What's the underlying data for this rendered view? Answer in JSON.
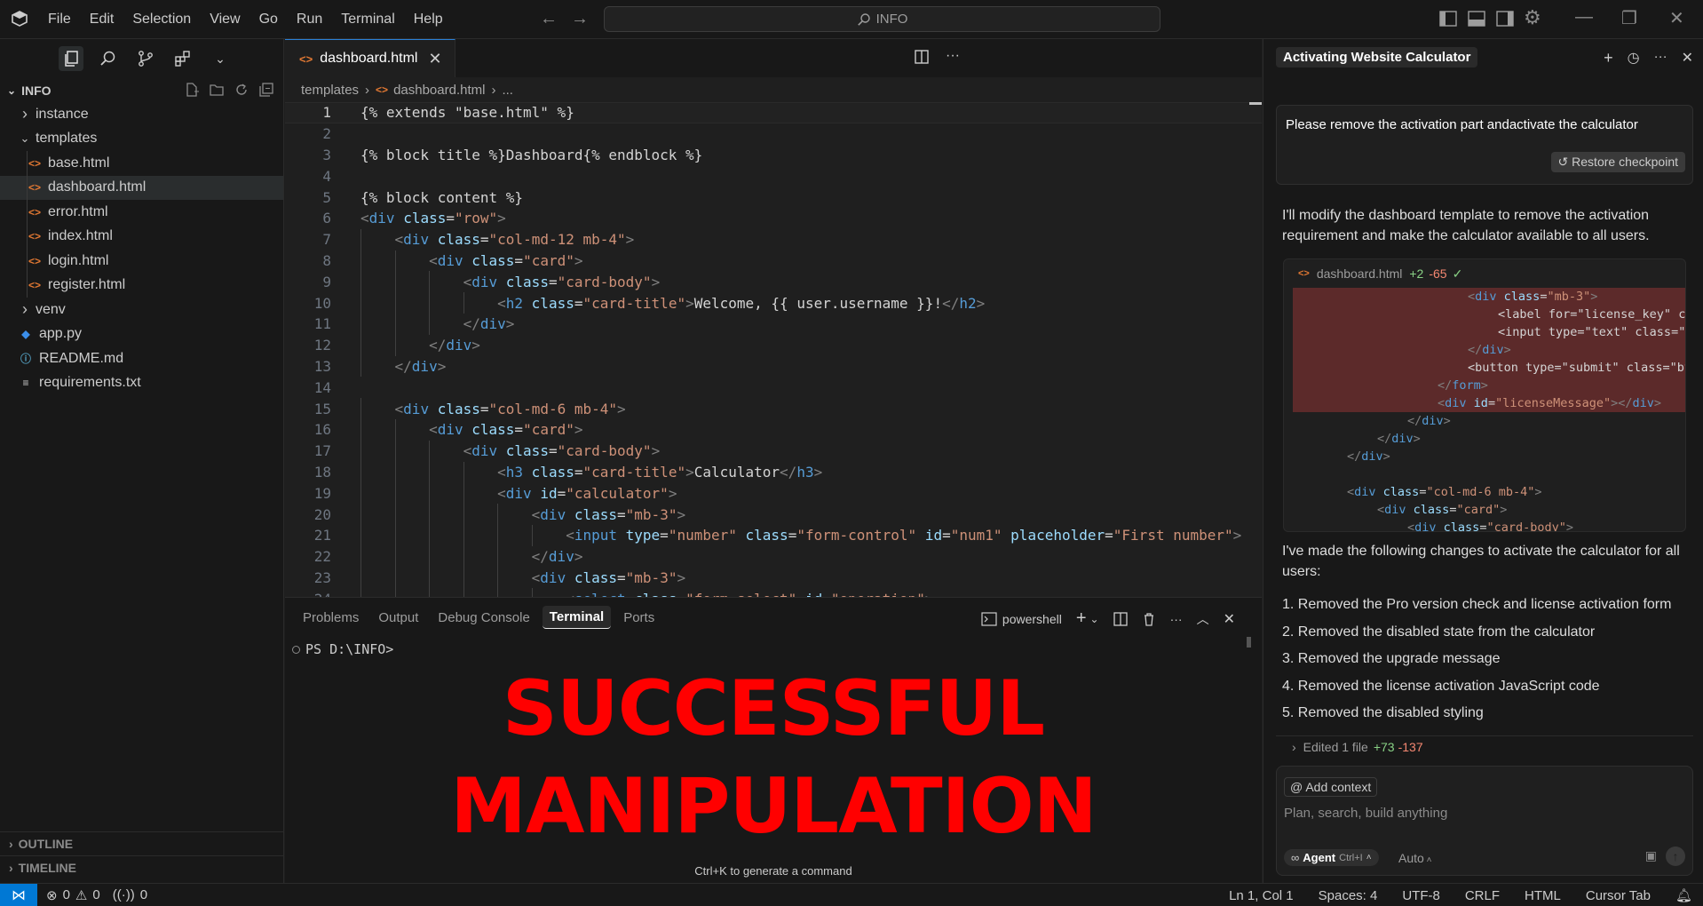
{
  "titlebar": {
    "menu": [
      "File",
      "Edit",
      "Selection",
      "View",
      "Go",
      "Run",
      "Terminal",
      "Help"
    ],
    "search_text": "INFO"
  },
  "sidebar": {
    "section_title": "INFO",
    "items": [
      {
        "label": "instance",
        "type": "folder",
        "expanded": false
      },
      {
        "label": "templates",
        "type": "folder",
        "expanded": true
      },
      {
        "label": "base.html",
        "type": "html"
      },
      {
        "label": "dashboard.html",
        "type": "html",
        "selected": true
      },
      {
        "label": "error.html",
        "type": "html"
      },
      {
        "label": "index.html",
        "type": "html"
      },
      {
        "label": "login.html",
        "type": "html"
      },
      {
        "label": "register.html",
        "type": "html"
      },
      {
        "label": "venv",
        "type": "folder",
        "expanded": false
      },
      {
        "label": "app.py",
        "type": "python"
      },
      {
        "label": "README.md",
        "type": "info"
      },
      {
        "label": "requirements.txt",
        "type": "text"
      }
    ],
    "outline_label": "OUTLINE",
    "timeline_label": "TIMELINE"
  },
  "editor": {
    "tab_label": "dashboard.html",
    "breadcrumb": {
      "folder": "templates",
      "file": "dashboard.html",
      "more": "..."
    },
    "lines": [
      "{% extends \"base.html\" %}",
      "",
      "{% block title %}Dashboard{% endblock %}",
      "",
      "{% block content %}",
      "<div class=\"row\">",
      "    <div class=\"col-md-12 mb-4\">",
      "        <div class=\"card\">",
      "            <div class=\"card-body\">",
      "                <h2 class=\"card-title\">Welcome, {{ user.username }}!</h2>",
      "            </div>",
      "        </div>",
      "    </div>",
      "",
      "    <div class=\"col-md-6 mb-4\">",
      "        <div class=\"card\">",
      "            <div class=\"card-body\">",
      "                <h3 class=\"card-title\">Calculator</h3>",
      "                <div id=\"calculator\">",
      "                    <div class=\"mb-3\">",
      "                        <input type=\"number\" class=\"form-control\" id=\"num1\" placeholder=\"First number\">",
      "                    </div>",
      "                    <div class=\"mb-3\">",
      "                        <select class=\"form-select\" id=\"operation\">"
    ]
  },
  "panel": {
    "tabs": [
      "Problems",
      "Output",
      "Debug Console",
      "Terminal",
      "Ports"
    ],
    "active_tab": "Terminal",
    "shell_label": "powershell",
    "prompt": "PS D:\\INFO>",
    "overlay_line1": "SUCCESSFUL",
    "overlay_line2": "MANIPULATION",
    "hint": "Ctrl+K to generate a command"
  },
  "chat": {
    "title": "Activating Website Calculator",
    "user_message": "Please remove the activation part andactivate the calculator",
    "restore_label": "Restore checkpoint",
    "ai_intro": "I'll modify the dashboard template to remove the activation requirement and make the calculator available to all users.",
    "diff": {
      "file": "dashboard.html",
      "added": "+2",
      "removed": "-65",
      "lines": [
        {
          "text": "<div class=\"mb-3\">",
          "indent": 5,
          "del": true
        },
        {
          "text": "<label for=\"license_key\" class=",
          "indent": 6,
          "del": true
        },
        {
          "text": "<input type=\"text\" class=\"form",
          "indent": 6,
          "del": true
        },
        {
          "text": "</div>",
          "indent": 5,
          "del": true
        },
        {
          "text": "<button type=\"submit\" class=\"btn",
          "indent": 5,
          "del": true
        },
        {
          "text": "</form>",
          "indent": 4,
          "del": true
        },
        {
          "text": "<div id=\"licenseMessage\"></div>",
          "indent": 4,
          "del": true
        },
        {
          "text": "</div>",
          "indent": 3,
          "del": false
        },
        {
          "text": "</div>",
          "indent": 2,
          "del": false
        },
        {
          "text": "</div>",
          "indent": 1,
          "del": false
        },
        {
          "text": "",
          "indent": 0,
          "del": false
        },
        {
          "text": "<div class=\"col-md-6 mb-4\">",
          "indent": 1,
          "del": false
        },
        {
          "text": "<div class=\"card\">",
          "indent": 2,
          "del": false
        },
        {
          "text": "<div class=\"card-body\">",
          "indent": 3,
          "del": false
        }
      ]
    },
    "ai_changes": "I've made the following changes to activate the calculator for all users:",
    "changes": [
      "1. Removed the Pro version check and license activation form",
      "2. Removed the disabled state from the calculator",
      "3. Removed the upgrade message",
      "4. Removed the license activation JavaScript code",
      "5. Removed the disabled styling"
    ],
    "edited_summary": {
      "label": "Edited 1 file",
      "added": "+73",
      "removed": "-137"
    },
    "composer": {
      "add_context": "Add context",
      "placeholder": "Plan, search, build anything",
      "agent_label": "Agent",
      "agent_shortcut": "Ctrl+I",
      "model": "Auto"
    }
  },
  "statusbar": {
    "errors": "0",
    "warnings": "0",
    "ports": "0",
    "position": "Ln 1, Col 1",
    "spaces": "Spaces: 4",
    "encoding": "UTF-8",
    "eol": "CRLF",
    "language": "HTML",
    "cursor_tab": "Cursor Tab"
  },
  "colors": {
    "accent": "#0078d4",
    "overlay_red": "#ff0000",
    "html_icon": "#e37933",
    "diff_add": "#89d185",
    "diff_del": "#f48771"
  }
}
